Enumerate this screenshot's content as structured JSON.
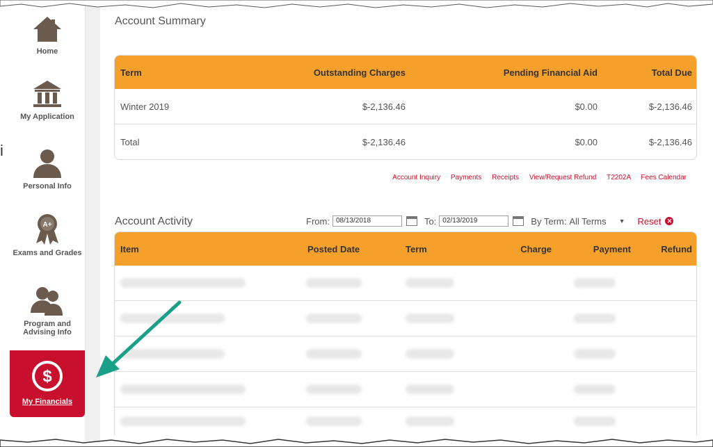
{
  "sidebar": {
    "items": [
      {
        "label": "Home",
        "icon": "home-icon"
      },
      {
        "label": "My Application",
        "icon": "institution-icon"
      },
      {
        "label": "Personal Info",
        "icon": "person-icon"
      },
      {
        "label": "Exams and Grades",
        "icon": "award-ribbon-icon"
      },
      {
        "label": "Program and Advising Info",
        "icon": "people-icon"
      },
      {
        "label": "My Financials",
        "icon": "dollar-circle-icon",
        "active": true
      }
    ],
    "active_color": "#c8102e"
  },
  "left_fragment": "i",
  "account_summary": {
    "title": "Account Summary",
    "headers": [
      "Term",
      "Outstanding Charges",
      "Pending Financial Aid",
      "Total Due"
    ],
    "rows": [
      [
        "Winter 2019",
        "$-2,136.46",
        "$0.00",
        "$-2,136.46"
      ],
      [
        "Total",
        "$-2,136.46",
        "$0.00",
        "$-2,136.46"
      ]
    ],
    "header_color": "#f6a02c"
  },
  "links": [
    "Account Inquiry",
    "Payments",
    "Receipts",
    "View/Request Refund",
    "T2202A",
    "Fees Calendar"
  ],
  "account_activity": {
    "title": "Account Activity",
    "from_label": "From:",
    "from_value": "08/13/2018",
    "to_label": "To:",
    "to_value": "02/13/2019",
    "by_term_label": "By Term:",
    "by_term_value": "All Terms",
    "reset_label": "Reset",
    "headers": [
      "Item",
      "Posted Date",
      "Term",
      "Charge",
      "Payment",
      "Refund"
    ],
    "rows_count_note": ""
  },
  "annotation_arrow_color": "#1aa088"
}
